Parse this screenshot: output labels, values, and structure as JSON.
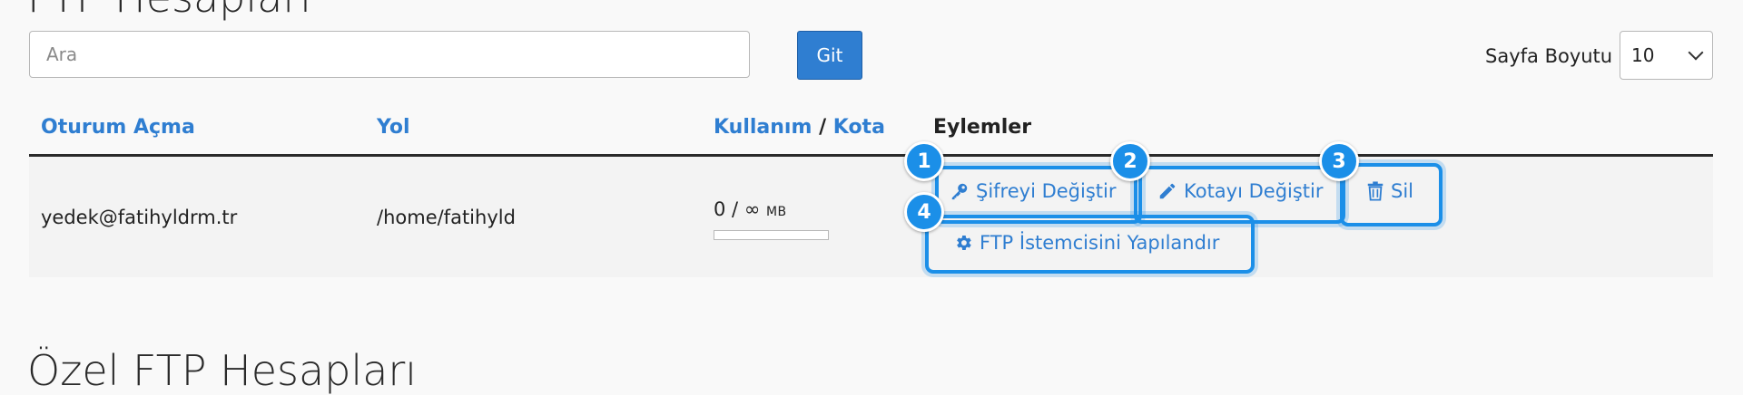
{
  "page_title": "FTP Hesapları",
  "section_title": "Özel FTP Hesapları",
  "search": {
    "placeholder": "Ara",
    "value": "",
    "go_label": "Git"
  },
  "page_size": {
    "label": "Sayfa Boyutu",
    "selected": "10"
  },
  "table": {
    "headers": {
      "login": "Oturum Açma",
      "path": "Yol",
      "usage": "Kullanım",
      "separator": "/",
      "quota": "Kota",
      "actions": "Eylemler"
    },
    "rows": [
      {
        "login": "yedek@fatihyldrm.tr",
        "path": "/home/fatihyld",
        "usage_text": "0 / ∞",
        "usage_unit": "MB",
        "usage_fraction": 0,
        "actions": {
          "change_password": "Şifreyi Değiştir",
          "change_quota": "Kotayı Değiştir",
          "delete": "Sil",
          "configure_client": "FTP İstemcisini Yapılandır"
        }
      }
    ]
  },
  "badges": [
    "1",
    "2",
    "3",
    "4"
  ],
  "icons": {
    "password": "key-icon",
    "quota": "pencil-icon",
    "delete": "trash-icon",
    "configure": "gear-icon"
  },
  "colors": {
    "accent": "#2f7ed1",
    "highlight": "#1b8fe8"
  }
}
